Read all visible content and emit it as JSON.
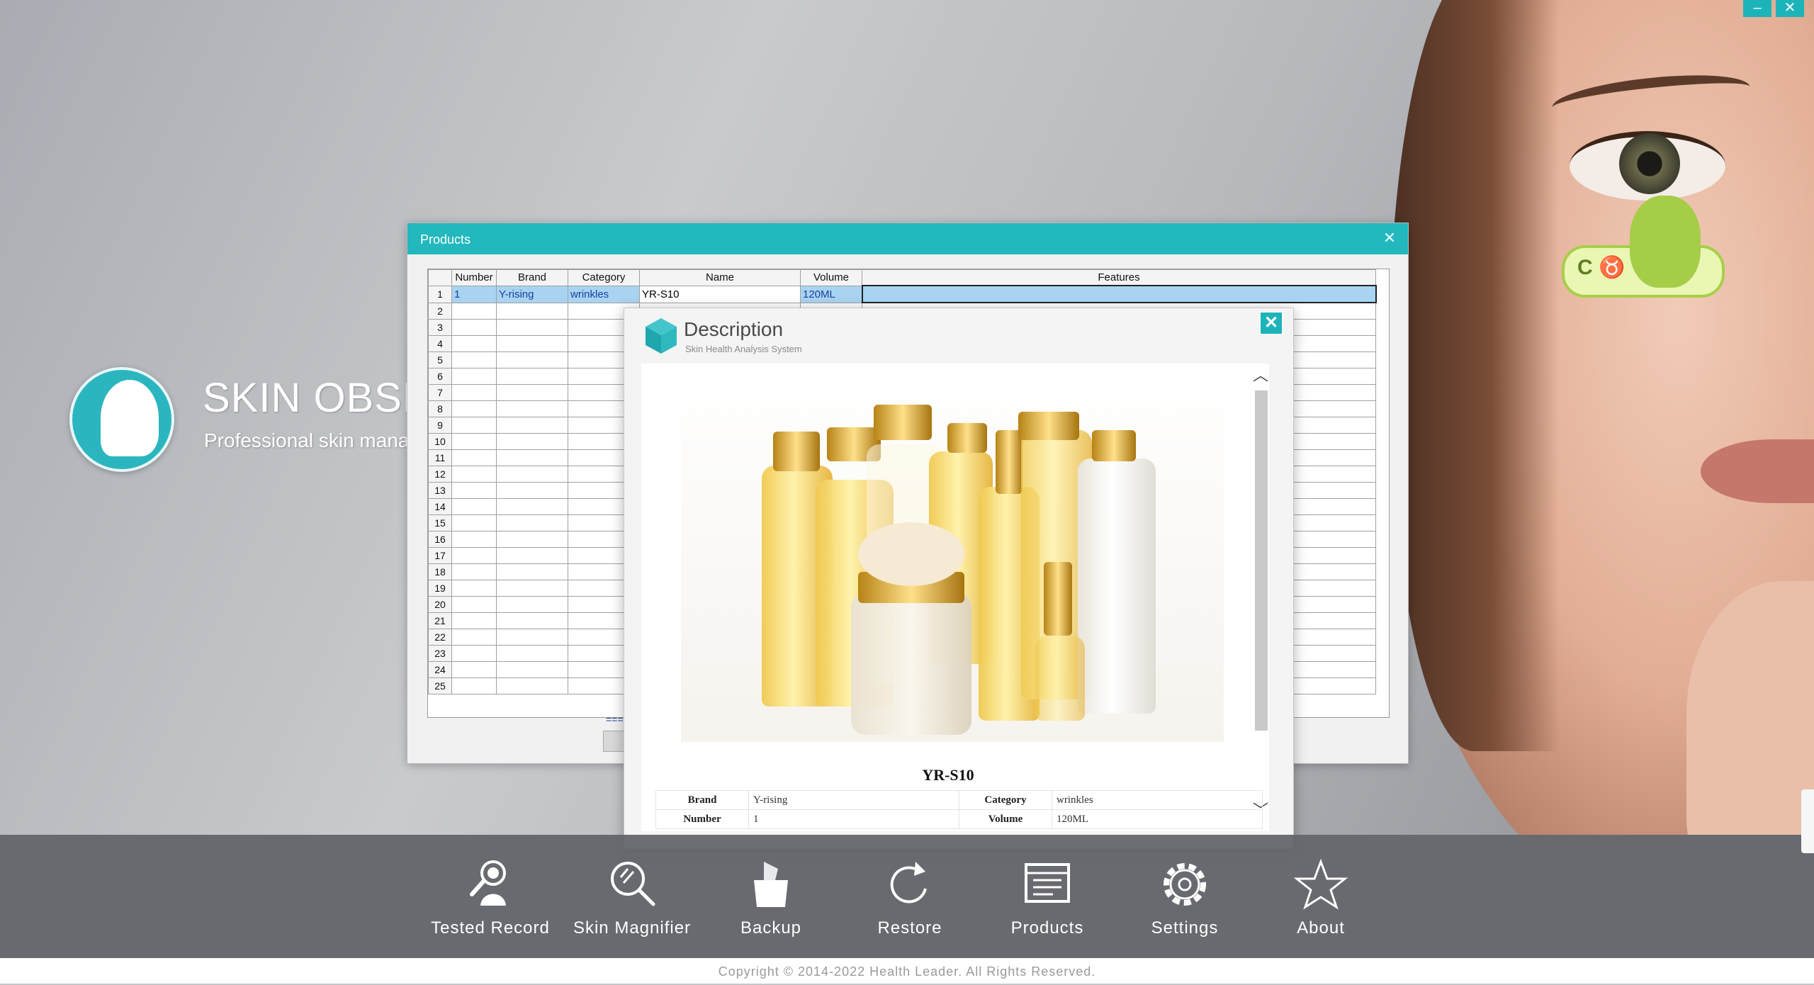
{
  "app": {
    "title": "SKIN OBSE",
    "subtitle": "Professional skin manag",
    "window_buttons": {
      "minimize": "–",
      "close": "✕"
    }
  },
  "mascot": {
    "text": "C ♉"
  },
  "products_window": {
    "title": "Products",
    "columns": [
      "Number",
      "Brand",
      "Category",
      "Name",
      "Volume",
      "Features"
    ],
    "selected_row": {
      "number": "1",
      "brand": "Y-rising",
      "category": "wrinkles",
      "name": "YR-S10",
      "volume": "120ML",
      "features": ""
    },
    "row_numbers": [
      "1",
      "2",
      "3",
      "4",
      "5",
      "6",
      "7",
      "8",
      "9",
      "10",
      "11",
      "12",
      "13",
      "14",
      "15",
      "16",
      "17",
      "18",
      "19",
      "20",
      "21",
      "22",
      "23",
      "24",
      "25"
    ],
    "dots": "===="
  },
  "description_dialog": {
    "heading": "Description",
    "tagline": "Skin Health Analysis System",
    "product_name": "YR-S10",
    "fields": [
      {
        "k1": "Brand",
        "v1": "Y-rising",
        "k2": "Category",
        "v2": "wrinkles"
      },
      {
        "k1": "Number",
        "v1": "1",
        "k2": "Volume",
        "v2": "120ML"
      }
    ],
    "close_label": "✕",
    "scroll_up": "︿",
    "scroll_down": "﹀"
  },
  "toolbar": {
    "items": [
      {
        "label": "Tested Record",
        "icon": "person-search-icon"
      },
      {
        "label": "Skin Magnifier",
        "icon": "magnifier-icon"
      },
      {
        "label": "Backup",
        "icon": "backup-folder-icon"
      },
      {
        "label": "Restore",
        "icon": "restore-icon"
      },
      {
        "label": "Products",
        "icon": "products-icon"
      },
      {
        "label": "Settings",
        "icon": "gear-icon"
      },
      {
        "label": "About",
        "icon": "star-icon"
      }
    ]
  },
  "footer": {
    "copyright": "Copyright © 2014-2022  Health Leader.  All Rights Reserved."
  },
  "colors": {
    "accent": "#22b8bd",
    "selection": "#a8d4f2",
    "toolbar": "#606268"
  }
}
